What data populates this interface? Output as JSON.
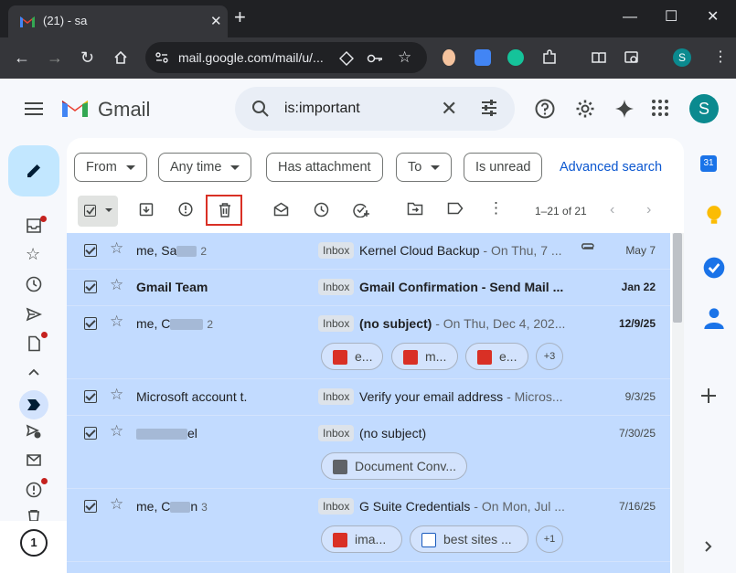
{
  "browser": {
    "tab_title": "(21) - sa",
    "tab_close": "✕",
    "new_tab": "+",
    "url": "mail.google.com/mail/u/...",
    "profile_initial": "S",
    "window_controls": {
      "minimize": "—",
      "maximize": "☐",
      "close": "✕"
    }
  },
  "gmail": {
    "logo_text": "Gmail",
    "search": {
      "value": "is:important",
      "clear": "✕"
    },
    "avatar_initial": "S",
    "filters": {
      "from": "From",
      "any_time": "Any time",
      "has_attachment": "Has attachment",
      "to": "To",
      "is_unread": "Is unread",
      "advanced": "Advanced search"
    },
    "pagination": "1–21 of 21",
    "inbox_label": "Inbox",
    "emails": [
      {
        "sender": "me, Sa",
        "count": "2",
        "subject": "Kernel Cloud Backup",
        "snippet": " - On Thu, 7 ...",
        "date": "May 7",
        "bold": false,
        "attachment_clip": true
      },
      {
        "sender": "Gmail Team",
        "count": "",
        "subject": "Gmail Confirmation - Send Mail ...",
        "snippet": "",
        "date": "Jan 22",
        "bold": true
      },
      {
        "sender": "me, C",
        "count": "2",
        "subject": "(no subject)",
        "snippet": " - On Thu, Dec 4, 202...",
        "date": "12/9/25",
        "bold": true,
        "attachments": [
          "e...",
          "m...",
          "e..."
        ],
        "more": "+3"
      },
      {
        "sender": "Microsoft account t.",
        "count": "",
        "subject": "Verify your email address",
        "snippet": " - Micros...",
        "date": "9/3/25",
        "bold": false
      },
      {
        "sender": "el",
        "count": "",
        "subject": "(no subject)",
        "snippet": "",
        "date": "7/30/25",
        "bold": false,
        "attachments": [
          "Document Conv..."
        ]
      },
      {
        "sender": "me, C",
        "sender_suffix": "n",
        "count": "3",
        "subject": "G Suite Credentials",
        "snippet": " - On Mon, Jul ...",
        "date": "7/16/25",
        "bold": false,
        "attachments": [
          "ima...",
          "best sites ..."
        ],
        "more": "+1"
      }
    ]
  },
  "icons": [
    "menu-icon",
    "search-icon",
    "tune-icon",
    "help-icon",
    "settings-icon",
    "gemini-icon",
    "apps-icon",
    "compose-icon",
    "inbox-icon",
    "star-icon",
    "clock-icon",
    "send-icon",
    "draft-icon",
    "chevron-up-icon",
    "label-icon",
    "scheduled-icon",
    "mail-icon",
    "spam-icon",
    "trash-icon",
    "archive-icon",
    "report-icon",
    "mark-read-icon",
    "snooze-icon",
    "add-task-icon",
    "move-icon",
    "label-outline-icon",
    "more-icon",
    "calendar-icon",
    "keep-icon",
    "tasks-icon",
    "contacts-icon",
    "plus-icon",
    "chevron-right-icon"
  ],
  "colors": {
    "accent": "#0b57d0",
    "selected_row": "#c2dbff",
    "highlight_box": "#d93025",
    "compose": "#c2e7ff"
  }
}
